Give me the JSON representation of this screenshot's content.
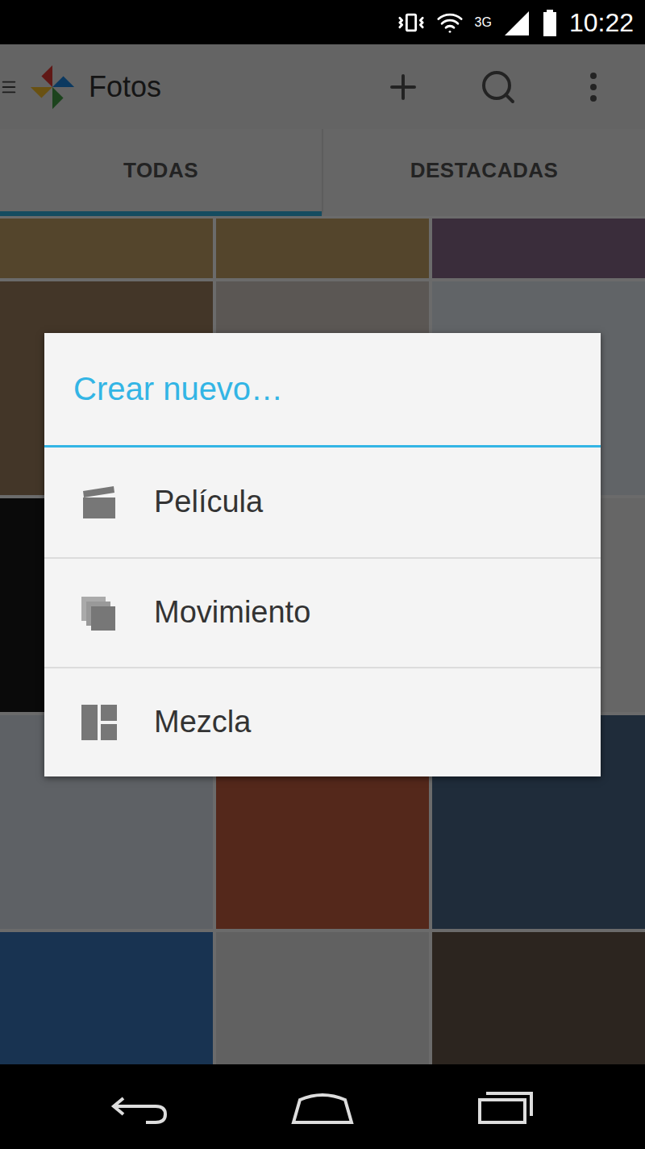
{
  "status_bar": {
    "network": "3G",
    "time": "10:22"
  },
  "app_bar": {
    "title": "Fotos"
  },
  "tabs": [
    {
      "label": "TODAS",
      "selected": true
    },
    {
      "label": "DESTACADAS",
      "selected": false
    }
  ],
  "photos": [
    {
      "color": "#c9a46a"
    },
    {
      "color": "#c9a46a"
    },
    {
      "color": "#8a6c8c"
    },
    {
      "color": "#a08060"
    },
    {
      "color": "#d8d0c8"
    },
    {
      "color": "#e8eef5"
    },
    {
      "color": "#1a1a1a"
    },
    {
      "color": "#f0f0f0"
    },
    {
      "color": "#f2f2f2"
    },
    {
      "color": "#e0e8f0"
    },
    {
      "color": "#c86040"
    },
    {
      "color": "#4a6a8a"
    },
    {
      "color": "#3a7ac0"
    },
    {
      "color": "#e8e8e8"
    },
    {
      "color": "#6a5a4a"
    }
  ],
  "dialog": {
    "title": "Crear nuevo…",
    "items": [
      {
        "label": "Película",
        "kind": "movie"
      },
      {
        "label": "Movimiento",
        "kind": "motion"
      },
      {
        "label": "Mezcla",
        "kind": "mix"
      }
    ]
  }
}
